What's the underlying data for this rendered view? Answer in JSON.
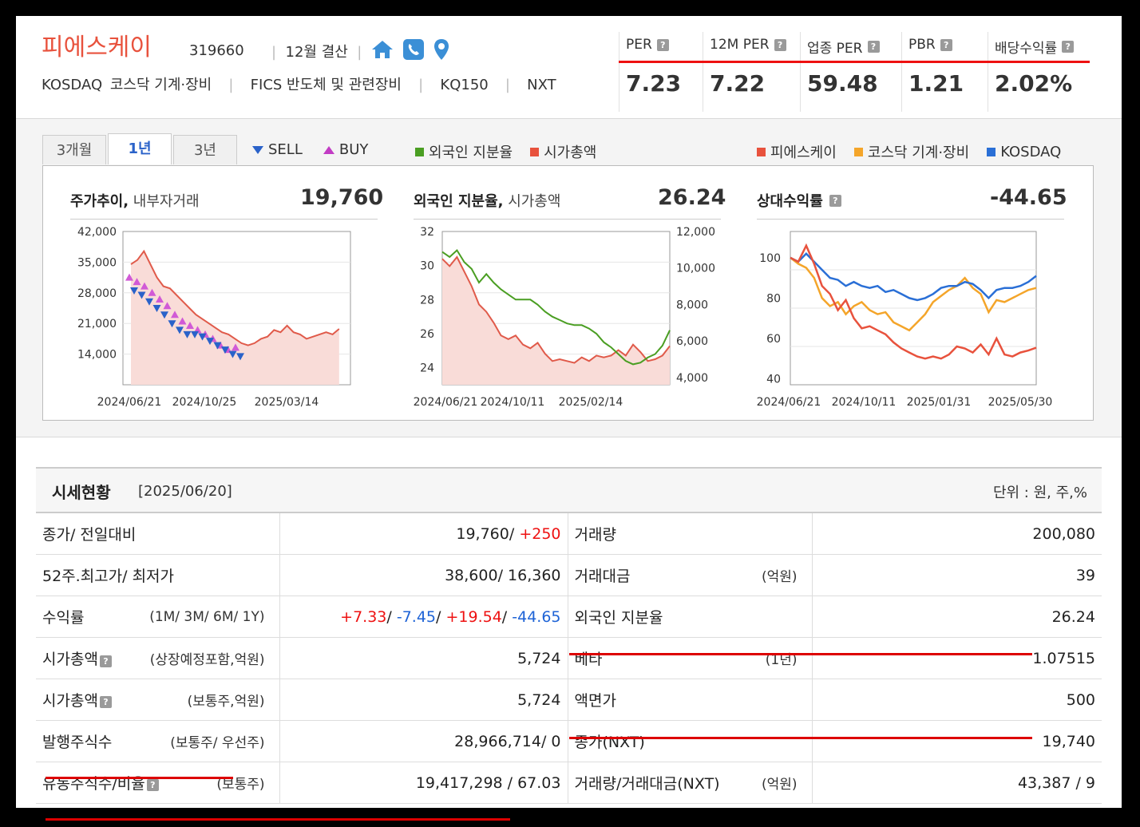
{
  "header": {
    "company_name": "피에스케이",
    "code": "319660",
    "settlement": "12월 결산",
    "icons": [
      "home-icon",
      "phone-icon",
      "location-pin-icon"
    ],
    "market": "KOSDAQ",
    "market_sector": "코스닥 기계·장비",
    "fics": "FICS 반도체 및 관련장비",
    "index": "KQ150",
    "nxt": "NXT"
  },
  "metrics": [
    {
      "label": "PER",
      "value": "7.23"
    },
    {
      "label": "12M PER",
      "value": "7.22"
    },
    {
      "label": "업종 PER",
      "value": "59.48"
    },
    {
      "label": "PBR",
      "value": "1.21"
    },
    {
      "label": "배당수익률",
      "value": "2.02%"
    }
  ],
  "chart_controls": {
    "tabs": [
      "3개월",
      "1년",
      "3년"
    ],
    "active_tab": "1년",
    "sell_label": "SELL",
    "buy_label": "BUY",
    "legend_mid": [
      {
        "name": "외국인 지분율",
        "color": "#4a9e22"
      },
      {
        "name": "시가총액",
        "color": "#e8523d"
      }
    ],
    "legend_right": [
      {
        "name": "피에스케이",
        "color": "#e8523d"
      },
      {
        "name": "코스닥 기계·장비",
        "color": "#f4a52a"
      },
      {
        "name": "KOSDAQ",
        "color": "#2a6fd6"
      }
    ]
  },
  "panels": {
    "price": {
      "title": "주가추이,",
      "subtitle": " 내부자거래",
      "value": "19,760"
    },
    "foreign": {
      "title": "외국인 지분율,",
      "subtitle": " 시가총액",
      "value": "26.24"
    },
    "relative": {
      "title": "상대수익률",
      "value": "-44.65"
    }
  },
  "chart_data": [
    {
      "type": "area",
      "title": "주가추이",
      "x_ticks": [
        "2024/06/21",
        "2024/10/25",
        "2025/03/14"
      ],
      "y_ticks": [
        "42,000",
        "35,000",
        "28,000",
        "21,000",
        "14,000"
      ],
      "ylim": [
        7000,
        42000
      ],
      "series": [
        {
          "values": [
            34500,
            35500,
            37500,
            34500,
            31500,
            29500,
            29000,
            27500,
            26000,
            24500,
            23000,
            22000,
            21000,
            20000,
            19000,
            18500,
            17500,
            16500,
            16000,
            16500,
            17500,
            18000,
            19500,
            19000,
            20500,
            19000,
            18500,
            17500,
            18000,
            18500,
            19000,
            18500,
            19760
          ]
        }
      ],
      "sell_markers": [
        28500,
        27500,
        26000,
        24500,
        23000,
        21000,
        19500,
        18500,
        18500,
        18000,
        17000,
        16000,
        15000,
        14000,
        13500
      ],
      "buy_markers": [
        31500,
        30500,
        29500,
        28000,
        26500,
        25000,
        23000,
        21500,
        20500,
        19500,
        18500,
        17500,
        16000,
        15000,
        15500
      ]
    },
    {
      "type": "line",
      "title": "외국인 지분율, 시가총액",
      "x_ticks": [
        "2024/06/21",
        "2024/10/11",
        "2025/02/14"
      ],
      "y_left_ticks": [
        "32",
        "30",
        "28",
        "26",
        "24"
      ],
      "y_right_ticks": [
        "12,000",
        "10,000",
        "8,000",
        "6,000",
        "4,000"
      ],
      "ylim_left": [
        23,
        32
      ],
      "ylim_right": [
        3600,
        12000
      ],
      "series": [
        {
          "name": "외국인 지분율",
          "axis": "left",
          "values": [
            30.8,
            30.5,
            30.9,
            30.2,
            29.8,
            29.0,
            29.5,
            29.0,
            28.6,
            28.3,
            28.0,
            28.0,
            28.0,
            27.7,
            27.3,
            27.0,
            26.8,
            26.6,
            26.5,
            26.5,
            26.3,
            26.0,
            25.5,
            25.2,
            24.8,
            24.4,
            24.2,
            24.3,
            24.6,
            24.8,
            25.3,
            26.2
          ]
        },
        {
          "name": "시가총액",
          "axis": "right",
          "values": [
            10500,
            10100,
            10600,
            9800,
            9000,
            8000,
            7600,
            7000,
            6300,
            6100,
            6300,
            5800,
            5600,
            5900,
            5300,
            4900,
            5000,
            4900,
            4800,
            5100,
            4900,
            5200,
            5100,
            5200,
            5500,
            5200,
            5800,
            5400,
            4900,
            5000,
            5200,
            5724
          ]
        }
      ]
    },
    {
      "type": "line",
      "title": "상대수익률",
      "x_ticks": [
        "2024/06/21",
        "2024/10/11",
        "2025/01/31",
        "2025/05/30"
      ],
      "y_ticks": [
        "100",
        "80",
        "60",
        "40"
      ],
      "ylim": [
        37,
        113
      ],
      "series": [
        {
          "name": "피에스케이",
          "values": [
            100,
            98,
            106,
            97,
            86,
            82,
            74,
            79,
            70,
            65,
            66,
            64,
            62,
            58,
            55,
            53,
            51,
            50,
            51,
            50,
            52,
            56,
            55,
            53,
            57,
            52,
            60,
            52,
            51,
            53,
            54,
            55.35
          ]
        },
        {
          "name": "코스닥 기계·장비",
          "values": [
            100,
            97,
            95,
            90,
            80,
            76,
            78,
            72,
            76,
            78,
            74,
            72,
            73,
            68,
            66,
            64,
            68,
            72,
            78,
            81,
            84,
            86,
            90,
            85,
            82,
            73,
            79,
            78,
            80,
            82,
            84,
            85
          ]
        },
        {
          "name": "KOSDAQ",
          "values": [
            100,
            98,
            102,
            98,
            94,
            90,
            89,
            86,
            88,
            86,
            85,
            86,
            83,
            84,
            82,
            80,
            79,
            80,
            82,
            85,
            86,
            86,
            88,
            87,
            84,
            80,
            84,
            85,
            85,
            86,
            88,
            91
          ]
        }
      ]
    }
  ],
  "table": {
    "title": "시세현황",
    "date": "[2025/06/20]",
    "unit": "단위 : 원, 주,%",
    "rows": [
      {
        "l_label": "종가/ 전일대비",
        "l_sub": "",
        "l_value": "19,760/",
        "l_value2": "+250",
        "r_label": "거래량",
        "r_sub": "",
        "r_value": "200,080"
      },
      {
        "l_label": "52주.최고가/ 최저가",
        "l_sub": "",
        "l_value": "38,600/ 16,360",
        "r_label": "거래대금",
        "r_sub": "(억원)",
        "r_value": "39"
      },
      {
        "l_label": "수익률",
        "l_sub": "(1M/ 3M/ 6M/ 1Y)",
        "r_label": "외국인 지분율",
        "r_sub": "",
        "r_value": "26.24"
      },
      {
        "l_label": "시가총액",
        "l_sub": "(상장예정포함,억원)",
        "l_value": "5,724",
        "r_label": "베타",
        "r_sub": "(1년)",
        "r_value": "1.07515"
      },
      {
        "l_label": "시가총액",
        "l_sub": "(보통주,억원)",
        "l_value": "5,724",
        "r_label": "액면가",
        "r_sub": "",
        "r_value": "500"
      },
      {
        "l_label": "발행주식수",
        "l_sub": "(보통주/ 우선주)",
        "l_value": "28,966,714/ 0",
        "r_label": "종가(NXT)",
        "r_sub": "",
        "r_value": "19,740"
      },
      {
        "l_label": "유동주식수/비율",
        "l_sub": "(보통주)",
        "l_value": "19,417,298 / 67.03",
        "r_label": "거래량/거래대금(NXT)",
        "r_sub": "(억원)",
        "r_value": "43,387 / 9"
      }
    ],
    "returns": [
      {
        "value": "+7.33",
        "color": "red"
      },
      {
        "value": "-7.45",
        "color": "blue"
      },
      {
        "value": "+19.54",
        "color": "red"
      },
      {
        "value": "-44.65",
        "color": "blue"
      }
    ]
  }
}
